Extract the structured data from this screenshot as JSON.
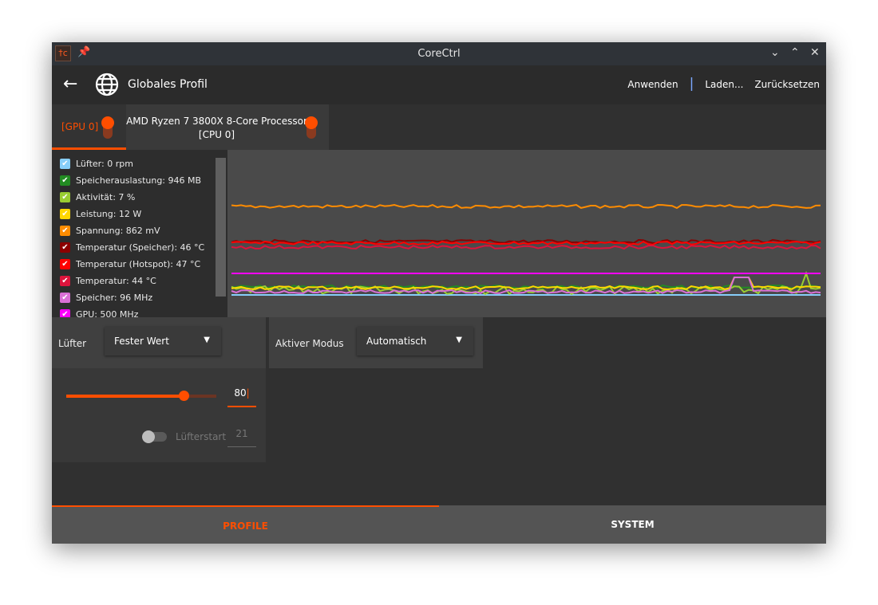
{
  "window": {
    "title": "CoreCtrl",
    "icon": "corectrl-logo-icon",
    "controls": [
      "minimize",
      "maximize",
      "close"
    ]
  },
  "header": {
    "title": "Globales Profil",
    "actions": {
      "apply": "Anwenden",
      "separator": "|",
      "load": "Laden...",
      "reset": "Zurücksetzen"
    }
  },
  "tabs": [
    {
      "label": "[GPU 0]",
      "active": true,
      "enabled": true
    },
    {
      "label": "AMD Ryzen 7 3800X 8-Core Processor",
      "sublabel": "[CPU 0]",
      "active": false,
      "enabled": true
    }
  ],
  "sensors": [
    {
      "label": "Lüfter: 0 rpm",
      "color": "#87cefa",
      "checked": true
    },
    {
      "label": "Speicherauslastung: 946 MB",
      "color": "#228b22",
      "checked": true
    },
    {
      "label": "Aktivität: 7 %",
      "color": "#9acd32",
      "checked": true
    },
    {
      "label": "Leistung: 12 W",
      "color": "#ffd700",
      "checked": true
    },
    {
      "label": "Spannung: 862 mV",
      "color": "#ff8c00",
      "checked": true
    },
    {
      "label": "Temperatur (Speicher): 46 °C",
      "color": "#8b0000",
      "checked": true
    },
    {
      "label": "Temperatur (Hotspot): 47 °C",
      "color": "#ff0000",
      "checked": true
    },
    {
      "label": "Temperatur: 44 °C",
      "color": "#dc143c",
      "checked": true
    },
    {
      "label": "Speicher: 96 MHz",
      "color": "#da70d6",
      "checked": true
    },
    {
      "label": "GPU: 500 MHz",
      "color": "#ff00ff",
      "checked": true
    }
  ],
  "fan": {
    "label": "Lüfter",
    "mode": "Fester Wert",
    "value": "80",
    "slider_percent": 80,
    "fanstart_label": "Lüfterstart",
    "fanstart_value": "21",
    "fanstart_enabled": false
  },
  "power": {
    "label": "Aktiver Modus",
    "mode": "Automatisch"
  },
  "bottom_nav": {
    "profile": "PROFILE",
    "system": "SYSTEM",
    "active": "profile"
  },
  "colors": {
    "accent": "#ff4e00"
  }
}
